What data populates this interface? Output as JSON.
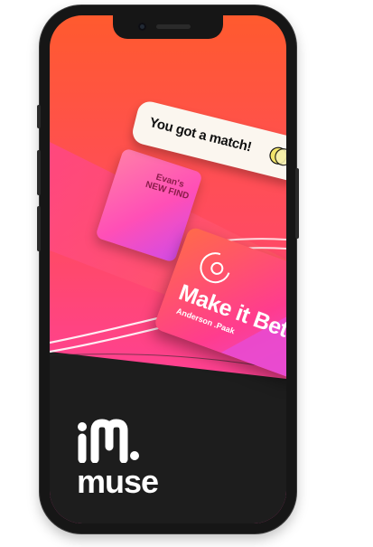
{
  "match_notification": {
    "text": "You got a match!",
    "avatar_icon": "match-avatar-icon"
  },
  "find_card": {
    "line1": "Evan's",
    "line2": "NEW FIND"
  },
  "track_card": {
    "title": "Make it Better",
    "artist": "Anderson .Paak",
    "logo_icon": "record-icon"
  },
  "brand": {
    "name": "muse",
    "logo_icon": "muse-logo-icon"
  },
  "colors": {
    "gradient_top": "#ff5a2e",
    "gradient_bottom": "#ff3fa6",
    "dark_base": "#1d1d1d",
    "bubble_bg": "#fbf6ef"
  }
}
